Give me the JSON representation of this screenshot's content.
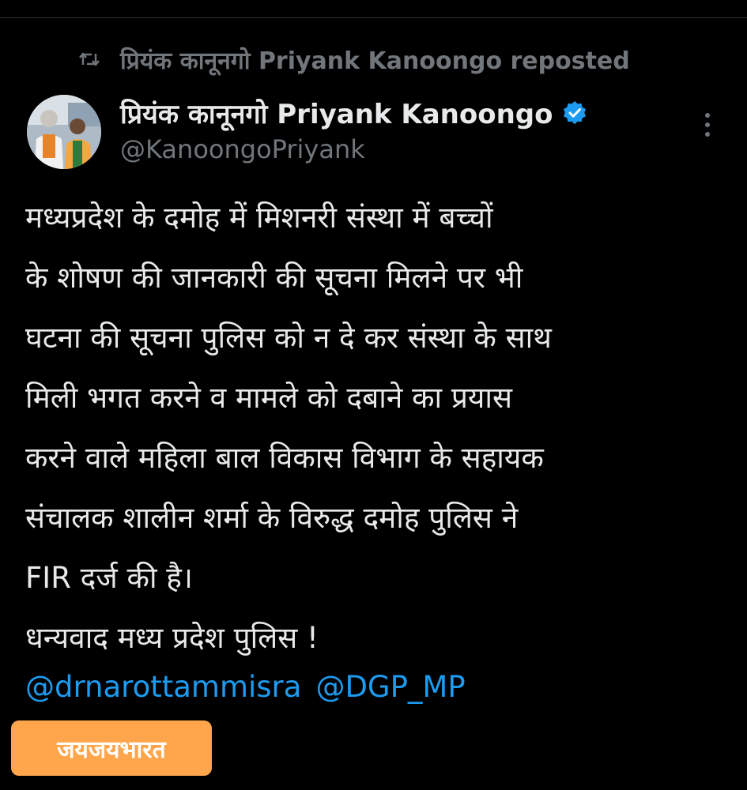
{
  "repost": {
    "icon": "repost-icon",
    "text": "प्रियंक कानूनगो Priyank Kanoongo reposted"
  },
  "author": {
    "avatar_icon": "avatar-photo",
    "display_name": "प्रियंक कानूनगो Priyank Kanoongo",
    "verified_icon": "verified-badge-icon",
    "handle": "@KanoongoPriyank"
  },
  "menu": {
    "icon": "more-vertical-icon"
  },
  "tweet": {
    "lines": [
      "मध्यप्रदेश के दमोह में मिशनरी संस्था में बच्चों",
      "के शोषण की जानकारी की सूचना मिलने पर भी",
      "घटना की सूचना पुलिस को न दे कर संस्था के साथ",
      "मिली भगत करने व मामले को दबाने का प्रयास",
      "करने वाले महिला बाल विकास विभाग के सहायक",
      "संचालक शालीन शर्मा के विरुद्ध दमोह पुलिस ने",
      "FIR दर्ज की है।",
      "धन्यवाद मध्य प्रदेश पुलिस !"
    ],
    "mentions": [
      "@drnarottammisra",
      "@DGP_MP"
    ]
  },
  "watermark": {
    "text": "जयजयभारत"
  },
  "colors": {
    "background": "#000000",
    "text": "#e7e9ea",
    "muted": "#71767b",
    "link": "#1d9bf0",
    "verified": "#1d9bf0",
    "watermark_bg": "#ffa64d"
  }
}
